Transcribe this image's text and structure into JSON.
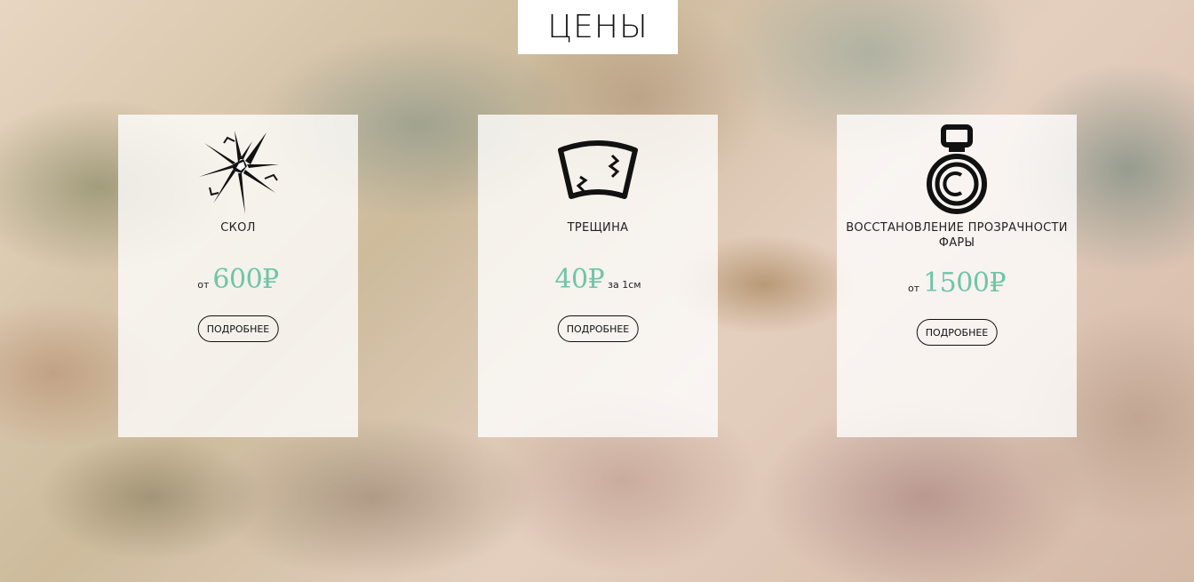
{
  "section_title": "ЦЕНЫ",
  "cards": [
    {
      "icon": "chip-crack-icon",
      "name": "СКОЛ",
      "prefix": "от",
      "price": "600₽",
      "suffix": "",
      "button": "ПОДРОБНЕЕ"
    },
    {
      "icon": "windshield-crack-icon",
      "name": "ТРЕЩИНА",
      "prefix": "",
      "price": "40₽",
      "suffix": "за 1см",
      "button": "ПОДРОБНЕЕ"
    },
    {
      "icon": "headlight-polish-icon",
      "name": "ВОССТАНОВЛЕНИЕ ПРОЗРАЧНОСТИ ФАРЫ",
      "prefix": "от",
      "price": "1500₽",
      "suffix": "",
      "button": "ПОДРОБНЕЕ"
    }
  ],
  "colors": {
    "price": "#6dc6a7",
    "text": "#222222",
    "card_bg": "rgba(255,255,255,0.78)"
  }
}
